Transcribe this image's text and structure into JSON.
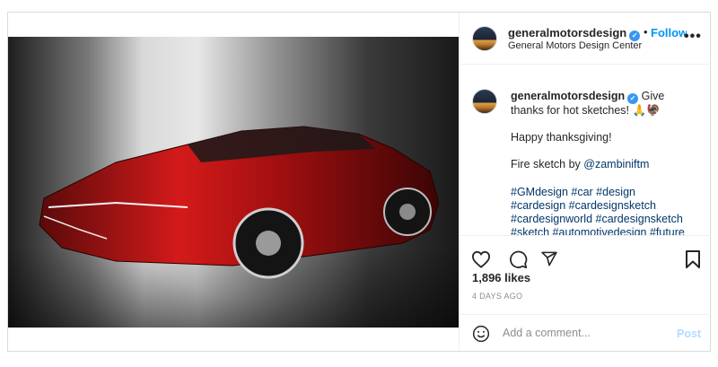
{
  "post": {
    "username": "generalmotorsdesign",
    "verified_mark": "✓",
    "separator": "•",
    "follow_label": "Follow",
    "subtitle": "General Motors Design Center",
    "more_label": "•••"
  },
  "caption": {
    "username": "generalmotorsdesign",
    "line1": "Give thanks for hot sketches! 🙏🦃",
    "line2": "Happy thanksgiving!",
    "line3_prefix": "Fire sketch by ",
    "mention": "@zambiniftm",
    "hashtags": [
      "#GMdesign #car #design",
      "#cardesign #cardesignsketch",
      "#cardesignworld #cardesignsketch",
      "#sketch #automotivedesign #future"
    ]
  },
  "actions": {
    "like_icon": "heart-icon",
    "comment_icon": "comment-icon",
    "share_icon": "share-icon",
    "save_icon": "bookmark-icon"
  },
  "stats": {
    "likes": "1,896 likes",
    "time": "4 DAYS AGO"
  },
  "comment_box": {
    "placeholder": "Add a comment...",
    "post_label": "Post",
    "emoji_icon": "smiley-icon"
  },
  "colors": {
    "link": "#0095f6",
    "hashtag": "#00376b",
    "post_disabled": "#b3dbff"
  }
}
